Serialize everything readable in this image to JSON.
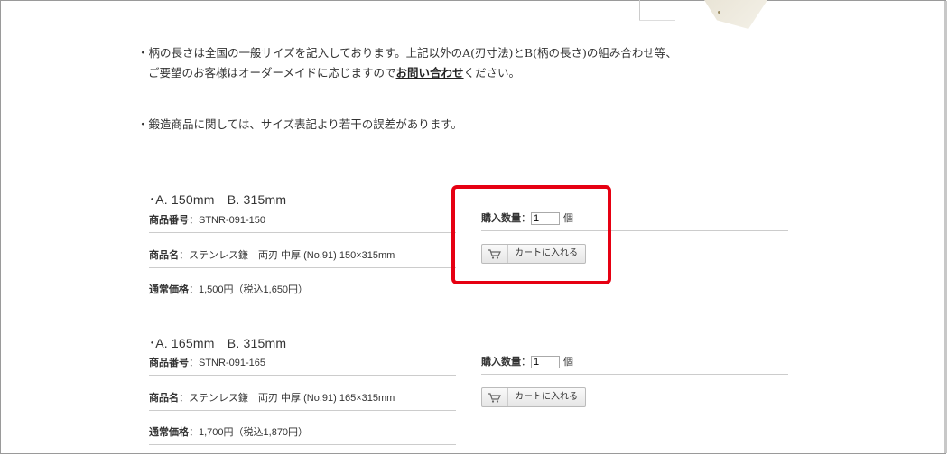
{
  "notes": {
    "note1_line1": "・柄の長さは全国の一般サイズを記入しております。上記以外のA(刃寸法)とB(柄の長さ)の組み合わせ等、",
    "note1_line2_before": "ご要望のお客様はオーダーメイドに応じますので",
    "note1_link": "お問い合わせ",
    "note1_line2_after": "ください。",
    "note2": "・鍛造商品に関しては、サイズ表記より若干の誤差があります。"
  },
  "products": [
    {
      "title": "･A. 150mm　B. 315mm",
      "code_label": "商品番号",
      "code_value": "：STNR-091-150",
      "name_label": "商品名",
      "name_value": "：ステンレス鎌　両刃 中厚 (No.91) 150×315mm",
      "price_label": "通常価格",
      "price_value": "：1,500円（税込1,650円）",
      "qty_label": "購入数量",
      "qty_colon": "：",
      "qty_value": "1",
      "qty_unit": "個",
      "cart_label": "カートに入れる"
    },
    {
      "title": "･A. 165mm　B. 315mm",
      "code_label": "商品番号",
      "code_value": "：STNR-091-165",
      "name_label": "商品名",
      "name_value": "：ステンレス鎌　両刃 中厚 (No.91) 165×315mm",
      "price_label": "通常価格",
      "price_value": "：1,700円（税込1,870円）",
      "qty_label": "購入数量",
      "qty_colon": "：",
      "qty_value": "1",
      "qty_unit": "個",
      "cart_label": "カートに入れる"
    }
  ],
  "icons": {
    "cart": "cart-icon"
  },
  "colors": {
    "highlight": "#e60012"
  }
}
